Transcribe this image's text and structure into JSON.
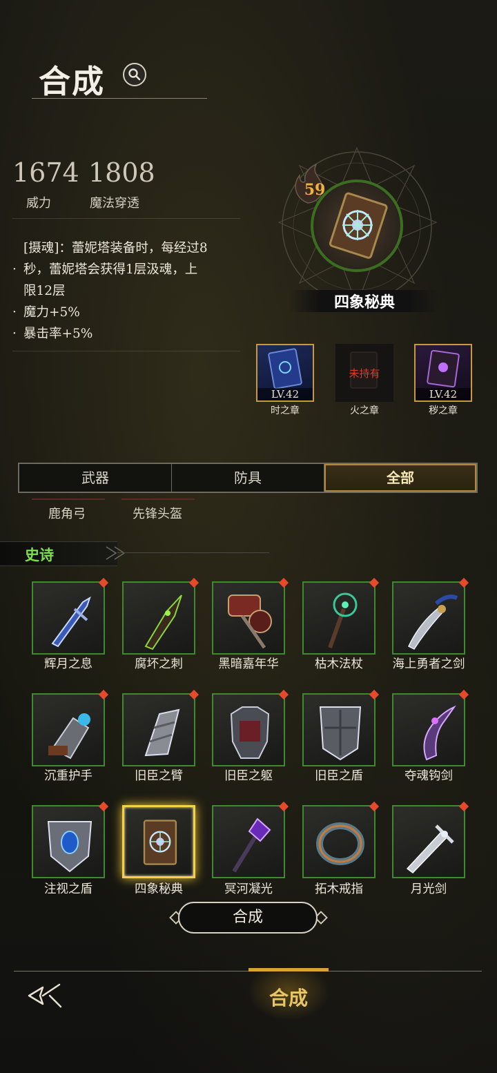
{
  "header": {
    "title": "合成"
  },
  "stats": [
    {
      "value": "1674",
      "label": "威力"
    },
    {
      "value": "1808",
      "label": "魔法穿透"
    }
  ],
  "description": {
    "lines": [
      {
        "bullet": "",
        "text": "[摄魂]：蕾妮塔装备时，每经过8"
      },
      {
        "bullet": "·",
        "text": "秒，蕾妮塔会获得1层汲魂，上"
      },
      {
        "bullet": "",
        "text": "限12层"
      },
      {
        "bullet": "·",
        "text": "魔力+5%"
      },
      {
        "bullet": "·",
        "text": "暴击率+5%"
      }
    ]
  },
  "featured": {
    "name": "四象秘典",
    "level": "59"
  },
  "chapters": [
    {
      "name": "时之章",
      "level": "LV.42"
    },
    {
      "name": "火之章",
      "status": "未持有"
    },
    {
      "name": "秽之章",
      "level": "LV.42"
    }
  ],
  "tabs": [
    {
      "label": "武器"
    },
    {
      "label": "防具"
    },
    {
      "label": "全部",
      "active": true
    }
  ],
  "sub_items": [
    "鹿角弓",
    "先锋头盔"
  ],
  "section": {
    "title": "史诗"
  },
  "grid": [
    {
      "label": "辉月之息",
      "icon": "sword-icon"
    },
    {
      "label": "腐坏之刺",
      "icon": "dagger-icon"
    },
    {
      "label": "黑暗嘉年华",
      "icon": "hammer-icon"
    },
    {
      "label": "枯木法杖",
      "icon": "staff-icon"
    },
    {
      "label": "海上勇者之剑",
      "icon": "saber-icon"
    },
    {
      "label": "沉重护手",
      "icon": "gauntlet-icon"
    },
    {
      "label": "旧臣之臂",
      "icon": "arm-guard-icon"
    },
    {
      "label": "旧臣之躯",
      "icon": "armor-icon"
    },
    {
      "label": "旧臣之盾",
      "icon": "shield-icon"
    },
    {
      "label": "夺魂钩剑",
      "icon": "hook-sword-icon"
    },
    {
      "label": "注视之盾",
      "icon": "eye-shield-icon"
    },
    {
      "label": "四象秘典",
      "icon": "book-icon",
      "selected": true
    },
    {
      "label": "冥河凝光",
      "icon": "scepter-icon"
    },
    {
      "label": "拓木戒指",
      "icon": "ring-icon"
    },
    {
      "label": "月光剑",
      "icon": "moon-sword-icon"
    }
  ],
  "buttons": {
    "combine": "合成"
  },
  "bottom_nav": {
    "active": "合成"
  },
  "colors": {
    "rarity_border": "#3f8a2c",
    "section_text": "#7ce04a",
    "accent_gold": "#e8c466",
    "new_dot": "#e64a2a"
  }
}
